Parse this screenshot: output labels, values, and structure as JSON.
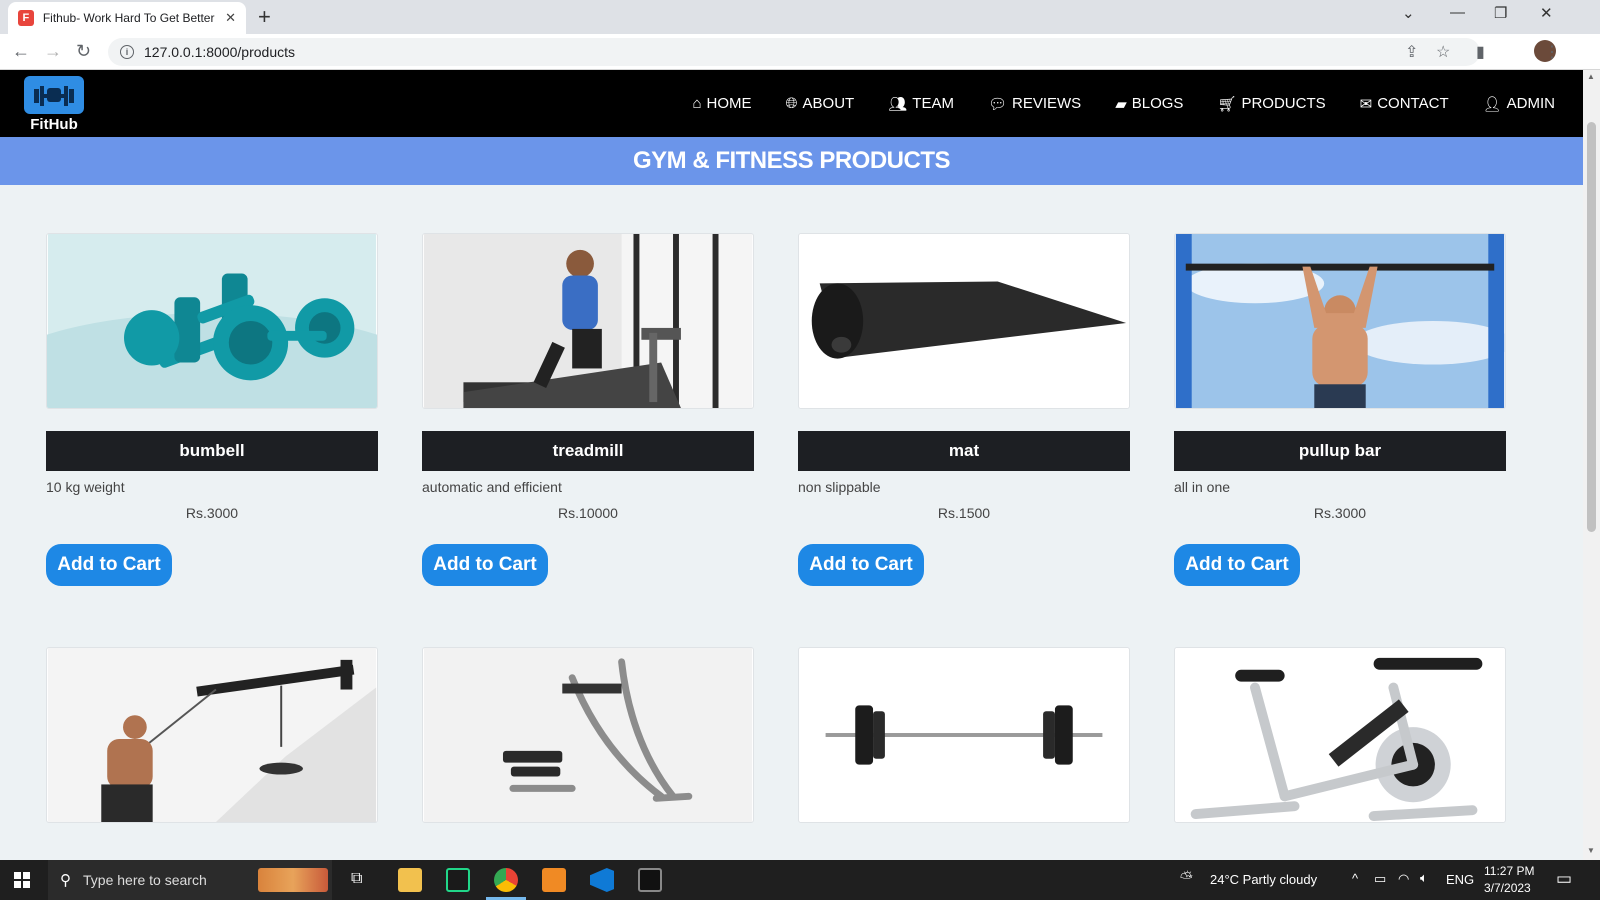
{
  "browser": {
    "tab_title": "Fithub- Work Hard To Get Better",
    "tab_close": "✕",
    "new_tab": "+",
    "url": "127.0.0.1:8000/products"
  },
  "nav": {
    "logo_text": "FitHub",
    "items": [
      {
        "label": "HOME",
        "icon": "home-icon"
      },
      {
        "label": "ABOUT",
        "icon": "globe-icon"
      },
      {
        "label": "TEAM",
        "icon": "users-icon"
      },
      {
        "label": "REVIEWS",
        "icon": "comment-icon"
      },
      {
        "label": "BLOGS",
        "icon": "chat-icon"
      },
      {
        "label": "PRODUCTS",
        "icon": "basket-icon"
      },
      {
        "label": "CONTACT",
        "icon": "envelope-icon"
      },
      {
        "label": "ADMIN",
        "icon": "user-icon"
      }
    ]
  },
  "banner": {
    "title": "GYM & FITNESS PRODUCTS"
  },
  "products": [
    {
      "name": "bumbell",
      "description": "10 kg weight",
      "price": "Rs.3000",
      "button": "Add to Cart",
      "image": "dumbbell"
    },
    {
      "name": "treadmill",
      "description": "automatic and efficient",
      "price": "Rs.10000",
      "button": "Add to Cart",
      "image": "treadmill"
    },
    {
      "name": "mat",
      "description": "non slippable",
      "price": "Rs.1500",
      "button": "Add to Cart",
      "image": "mat"
    },
    {
      "name": "pullup bar",
      "description": "all in one",
      "price": "Rs.3000",
      "button": "Add to Cart",
      "image": "pullup-bar"
    }
  ],
  "products_row2_images": [
    "cable-pulley",
    "ab-machine",
    "barbell",
    "spin-bike"
  ],
  "taskbar": {
    "search_placeholder": "Type here to search",
    "weather": "24°C  Partly cloudy",
    "language": "ENG",
    "time": "11:27 PM",
    "date": "3/7/2023"
  },
  "colors": {
    "nav_bg": "#000000",
    "banner_bg": "#6b95ea",
    "button_bg": "#1e88e5",
    "card_title_bg": "#1d1f23",
    "page_bg": "#edf2f4"
  }
}
